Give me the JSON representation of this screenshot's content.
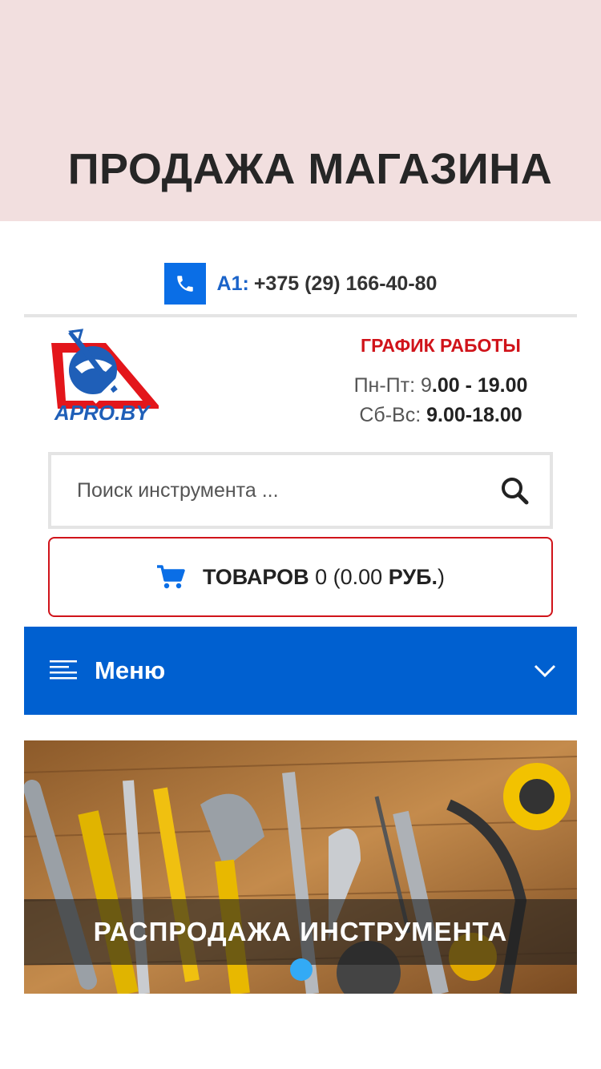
{
  "banner": {
    "title": "ПРОДАЖА МАГАЗИНА"
  },
  "contact": {
    "operator": "A1:",
    "phone": "+375 (29) 166-40-80"
  },
  "logo": {
    "text": "APRO.BY"
  },
  "schedule": {
    "title": "ГРАФИК РАБОТЫ",
    "weekdays_label": "Пн-Пт: 9",
    "weekdays_hours": ".00 - 19.00",
    "weekend_label": "Сб-Вс:",
    "weekend_hours": "9.00-18.00"
  },
  "search": {
    "placeholder": "Поиск инструмента ..."
  },
  "cart": {
    "label": "ТОВАРОВ",
    "summary": "0 (0.00",
    "currency": "РУБ.",
    "close": ")"
  },
  "menu": {
    "label": "Меню"
  },
  "slider": {
    "caption": "РАСПРОДАЖА ИНСТРУМЕНТА",
    "active_slide": 1,
    "slide_count": 1
  },
  "colors": {
    "banner_bg": "#f2dfdf",
    "accent_blue": "#0060d0",
    "phone_blue": "#0a6ee6",
    "schedule_red": "#d0131a",
    "slider_dot": "#33aaf5"
  },
  "icons": [
    "phone-icon",
    "search-icon",
    "cart-icon",
    "hamburger-icon",
    "chevron-down-icon"
  ]
}
